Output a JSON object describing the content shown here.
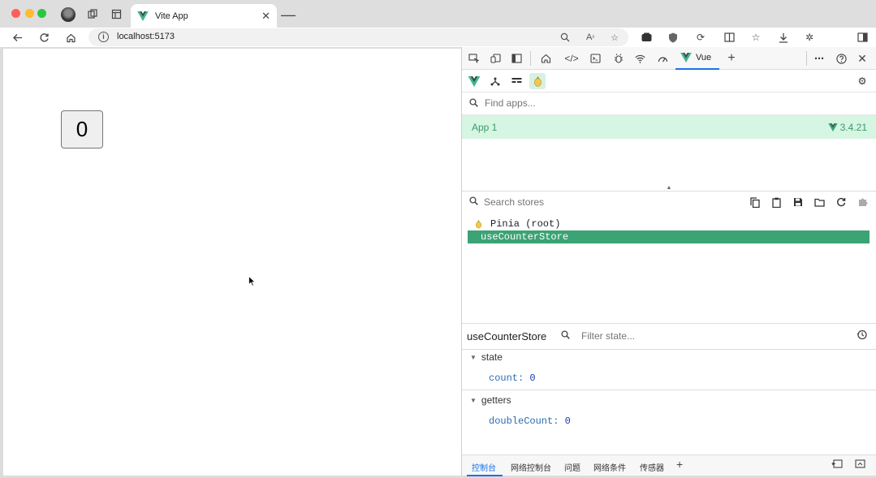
{
  "browser": {
    "tab_title": "Vite App",
    "url": "localhost:5173",
    "colors": {
      "close": "#ff5f57",
      "minimize": "#febc2e",
      "maximize": "#28c840"
    }
  },
  "page": {
    "counter_value": "0"
  },
  "devtools": {
    "vue_tab_label": "Vue",
    "find_apps_placeholder": "Find apps...",
    "app": {
      "name": "App 1",
      "version": "3.4.21"
    },
    "search_stores_placeholder": "Search stores",
    "tree": {
      "root": "Pinia (root)",
      "selected": "useCounterStore"
    },
    "inspector": {
      "store_name": "useCounterStore",
      "filter_placeholder": "Filter state...",
      "state_label": "state",
      "state_key": "count",
      "state_value": "0",
      "getters_label": "getters",
      "getter_key": "doubleCount",
      "getter_value": "0"
    },
    "drawer_tabs": [
      "控制台",
      "网络控制台",
      "问题",
      "网络条件",
      "传感器"
    ],
    "colors": {
      "accent": "#3ba374",
      "selected_app_bg": "#d6f5e3",
      "active_tab": "#1a73e8"
    }
  }
}
